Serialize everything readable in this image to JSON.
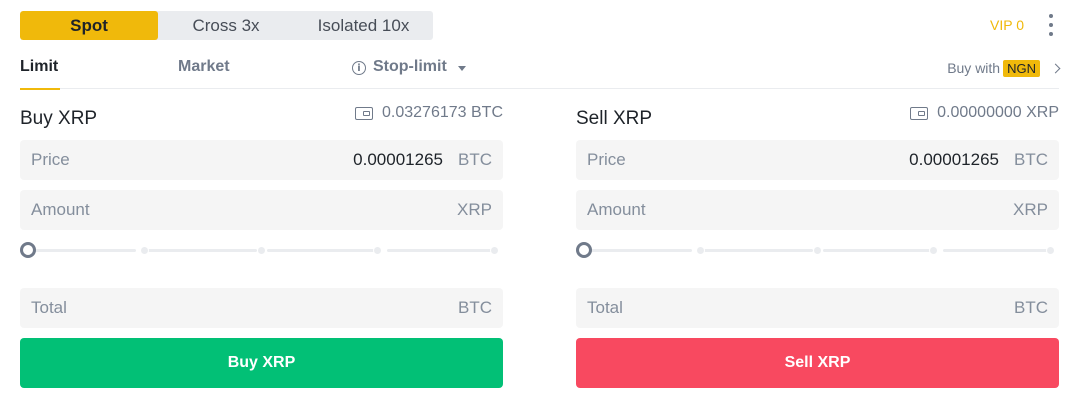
{
  "mode_tabs": [
    {
      "label": "Spot",
      "active": true
    },
    {
      "label": "Cross 3x",
      "active": false
    },
    {
      "label": "Isolated 10x",
      "active": false
    }
  ],
  "header": {
    "vip_label": "VIP 0"
  },
  "order_tabs": {
    "limit": "Limit",
    "market": "Market",
    "stop_limit": "Stop-limit",
    "active": "Limit"
  },
  "buy_with": {
    "label": "Buy with",
    "currency": "NGN"
  },
  "buy_panel": {
    "title": "Buy XRP",
    "balance": "0.03276173 BTC",
    "price_label": "Price",
    "price_value": "0.00001265",
    "price_unit": "BTC",
    "amount_label": "Amount",
    "amount_unit": "XRP",
    "slider_value": 0,
    "total_label": "Total",
    "total_unit": "BTC",
    "button_label": "Buy XRP"
  },
  "sell_panel": {
    "title": "Sell XRP",
    "balance": "0.00000000 XRP",
    "price_label": "Price",
    "price_value": "0.00001265",
    "price_unit": "BTC",
    "amount_label": "Amount",
    "amount_unit": "XRP",
    "slider_value": 0,
    "total_label": "Total",
    "total_unit": "BTC",
    "button_label": "Sell XRP"
  },
  "colors": {
    "accent": "#f0b90b",
    "buy": "#02c076",
    "sell": "#f84960",
    "field_bg": "#f5f5f5",
    "muted_text": "#848e9c"
  },
  "icons": [
    "info-icon",
    "dropdown-caret-icon",
    "chevron-right-icon",
    "wallet-icon",
    "more-vertical-icon"
  ]
}
